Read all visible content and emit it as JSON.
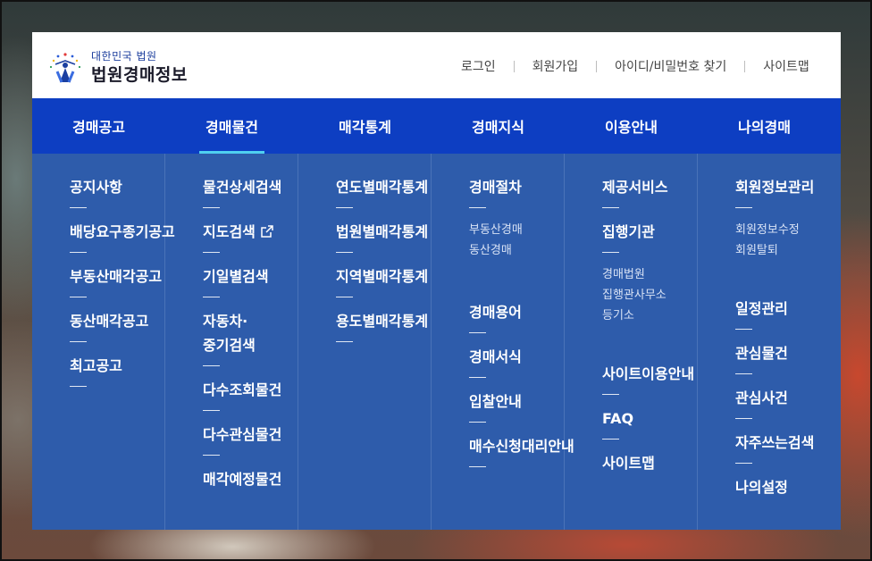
{
  "logo": {
    "sub": "대한민국 법원",
    "title": "법원경매정보"
  },
  "util_links": [
    "로그인",
    "회원가입",
    "아이디/비밀번호 찾기",
    "사이트맵"
  ],
  "nav": [
    "경매공고",
    "경매물건",
    "매각통계",
    "경매지식",
    "이용안내",
    "나의경매"
  ],
  "menu": {
    "col0": {
      "items": [
        "공지사항",
        "배당요구종기공고",
        "부동산매각공고",
        "동산매각공고",
        "최고공고"
      ]
    },
    "col1": {
      "items": [
        "물건상세검색",
        "지도검색",
        "기일별검색",
        "자동차·중기검색",
        "다수조회물건",
        "다수관심물건",
        "매각예정물건"
      ]
    },
    "col2": {
      "items": [
        "연도별매각통계",
        "법원별매각통계",
        "지역별매각통계",
        "용도별매각통계"
      ]
    },
    "col3": {
      "item0": "경매절차",
      "item0_subs": [
        "부동산경매",
        "동산경매"
      ],
      "items_rest": [
        "경매용어",
        "경매서식",
        "입찰안내",
        "매수신청대리안내"
      ]
    },
    "col4": {
      "item0": "제공서비스",
      "item1": "집행기관",
      "item1_subs": [
        "경매법원",
        "집행관사무소",
        "등기소"
      ],
      "items_rest": [
        "사이트이용안내",
        "FAQ",
        "사이트맵"
      ]
    },
    "col5": {
      "item0": "회원정보관리",
      "item0_subs": [
        "회원정보수정",
        "회원탈퇴"
      ],
      "items_rest": [
        "일정관리",
        "관심물건",
        "관심사건",
        "자주쓰는검색",
        "나의설정"
      ]
    }
  }
}
